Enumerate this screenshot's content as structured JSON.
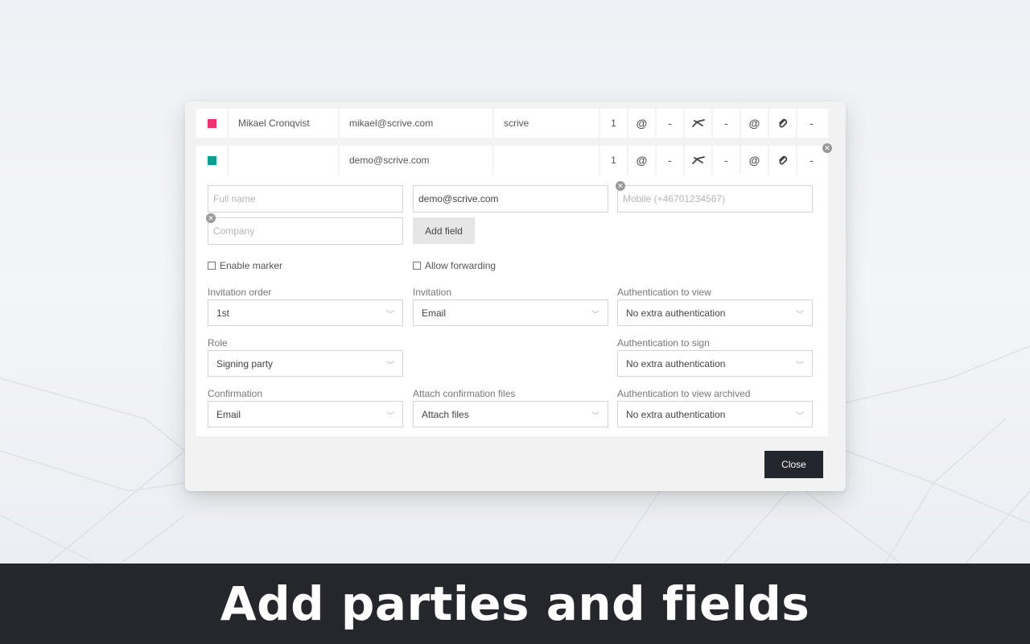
{
  "parties": [
    {
      "color": "#f0306f",
      "name": "Mikael Cronqvist",
      "email": "mikael@scrive.com",
      "company": "scrive",
      "order": "1",
      "invite_method": "@",
      "col2": "-",
      "col4": "-",
      "confirm": "@",
      "col7": "-"
    },
    {
      "color": "#0b9e91",
      "name": "",
      "email": "demo@scrive.com",
      "company": "",
      "order": "1",
      "invite_method": "@",
      "col2": "-",
      "col4": "-",
      "confirm": "@",
      "col7": "-"
    }
  ],
  "details": {
    "fullname_placeholder": "Full name",
    "email_value": "demo@scrive.com",
    "mobile_placeholder": "Mobile (+46701234567)",
    "company_placeholder": "Company",
    "add_field_label": "Add field",
    "enable_marker_label": "Enable marker",
    "allow_forwarding_label": "Allow forwarding",
    "invitation_order": {
      "label": "Invitation order",
      "value": "1st"
    },
    "invitation": {
      "label": "Invitation",
      "value": "Email"
    },
    "auth_view": {
      "label": "Authentication to view",
      "value": "No extra authentication"
    },
    "role": {
      "label": "Role",
      "value": "Signing party"
    },
    "auth_sign": {
      "label": "Authentication to sign",
      "value": "No extra authentication"
    },
    "confirmation": {
      "label": "Confirmation",
      "value": "Email"
    },
    "attach_files": {
      "label": "Attach confirmation files",
      "value": "Attach files"
    },
    "auth_archived": {
      "label": "Authentication to view archived",
      "value": "No extra authentication"
    }
  },
  "close_label": "Close",
  "banner_text": "Add parties and fields",
  "colors": {
    "dark": "#25272c",
    "accent_pink": "#f0306f",
    "accent_teal": "#0b9e91"
  }
}
